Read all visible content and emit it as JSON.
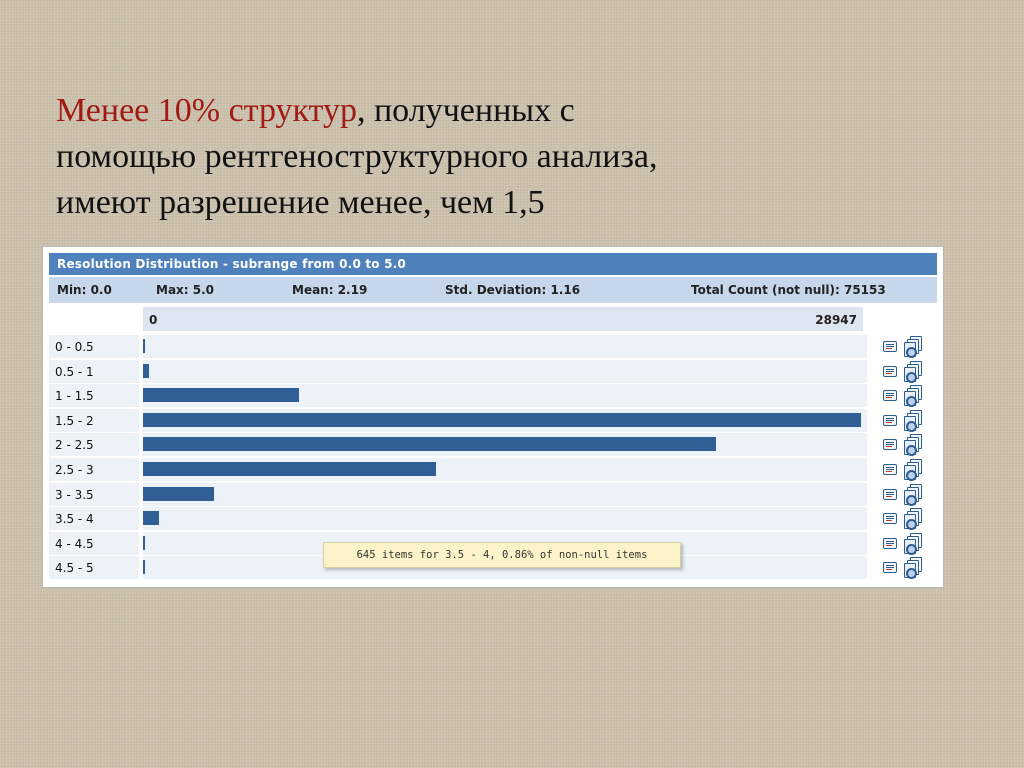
{
  "slide": {
    "accent_text": "Менее 10% структур",
    "line1_rest": ", полученных с",
    "line2": "помощью рентгеноструктурного анализа,",
    "line3": "имеют разрешение менее, чем 1,5"
  },
  "panel": {
    "title": "Resolution Distribution - subrange from 0.0 to 5.0",
    "stats": {
      "min": "Min: 0.0",
      "max": "Max: 5.0",
      "mean": "Mean: 2.19",
      "std": "Std. Deviation: 1.16",
      "total": "Total Count (not null): 75153"
    },
    "scale_min": "0",
    "scale_max": "28947",
    "tooltip": "645 items for 3.5 - 4,  0.86% of non-null items"
  },
  "chart_data": {
    "type": "bar",
    "orientation": "horizontal",
    "title": "Resolution Distribution - subrange from 0.0 to 5.0",
    "categories": [
      "0 - 0.5",
      "0.5 - 1",
      "1 - 1.5",
      "1.5 - 2",
      "2 - 2.5",
      "2.5 - 3",
      "3 - 3.5",
      "3.5 - 4",
      "4 - 4.5",
      "4.5 - 5"
    ],
    "values": [
      50,
      260,
      6300,
      28947,
      23100,
      11800,
      2850,
      645,
      60,
      80
    ],
    "xlim": [
      0,
      28947
    ],
    "bar_color": "#2f5f95"
  },
  "icons": {
    "row_action_1": "report-icon",
    "row_action_2": "stacked-documents-icon"
  }
}
